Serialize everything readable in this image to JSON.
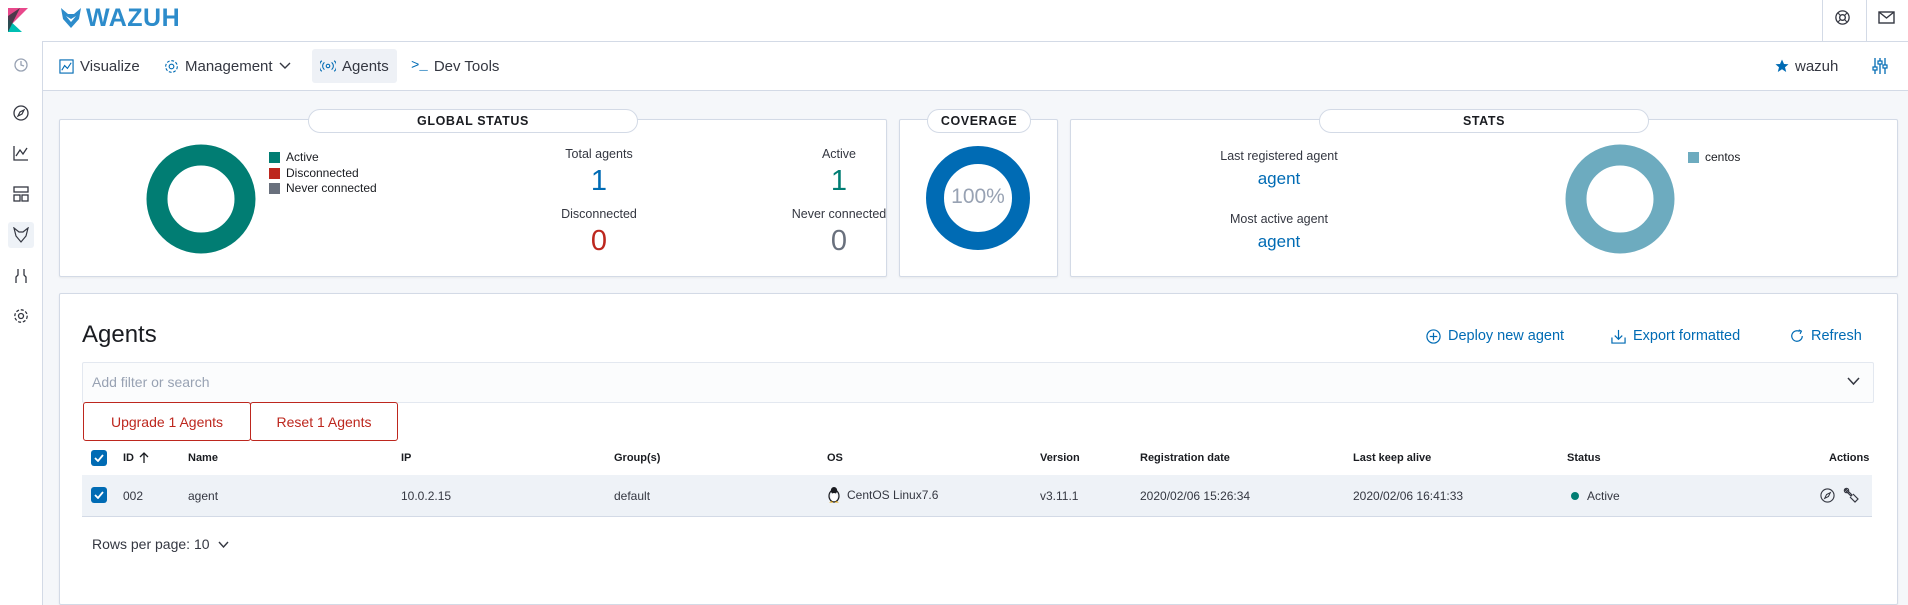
{
  "brand": {
    "name": "WAZUH"
  },
  "nav": {
    "items": [
      {
        "label": "Visualize",
        "icon": "visualize-icon"
      },
      {
        "label": "Management",
        "icon": "gear-icon"
      },
      {
        "label": "Agents",
        "icon": "agents-icon"
      },
      {
        "label": "Dev Tools",
        "icon": "devtools-icon"
      }
    ],
    "user": "wazuh"
  },
  "global_status": {
    "title": "GLOBAL STATUS",
    "legend": [
      {
        "label": "Active",
        "color": "#017d73"
      },
      {
        "label": "Disconnected",
        "color": "#bd271e"
      },
      {
        "label": "Never connected",
        "color": "#69707d"
      }
    ],
    "total_agents_label": "Total agents",
    "total_agents": "1",
    "active_label": "Active",
    "active": "1",
    "disconnected_label": "Disconnected",
    "disconnected": "0",
    "never_connected_label": "Never connected",
    "never_connected": "0",
    "donut_color": "#017d73"
  },
  "coverage": {
    "title": "COVERAGE",
    "value": "100%",
    "color": "#006bb4"
  },
  "stats": {
    "title": "STATS",
    "last_registered_label": "Last registered agent",
    "last_registered": "agent",
    "most_active_label": "Most active agent",
    "most_active": "agent",
    "legend": [
      {
        "label": "centos",
        "color": "#6dabbf"
      }
    ]
  },
  "agents": {
    "title": "Agents",
    "actions": {
      "deploy": "Deploy new agent",
      "export": "Export formatted",
      "refresh": "Refresh"
    },
    "search_placeholder": "Add filter or search",
    "upgrade_label": "Upgrade 1 Agents",
    "reset_label": "Reset 1 Agents",
    "columns": [
      "ID",
      "Name",
      "IP",
      "Group(s)",
      "OS",
      "Version",
      "Registration date",
      "Last keep alive",
      "Status",
      "Actions"
    ],
    "rows": [
      {
        "id": "002",
        "name": "agent",
        "ip": "10.0.2.15",
        "groups": "default",
        "os": "CentOS Linux7.6",
        "version": "v3.11.1",
        "registration_date": "2020/02/06 15:26:34",
        "last_keep_alive": "2020/02/06 16:41:33",
        "status": "Active"
      }
    ],
    "rows_per_page": "Rows per page: 10"
  }
}
